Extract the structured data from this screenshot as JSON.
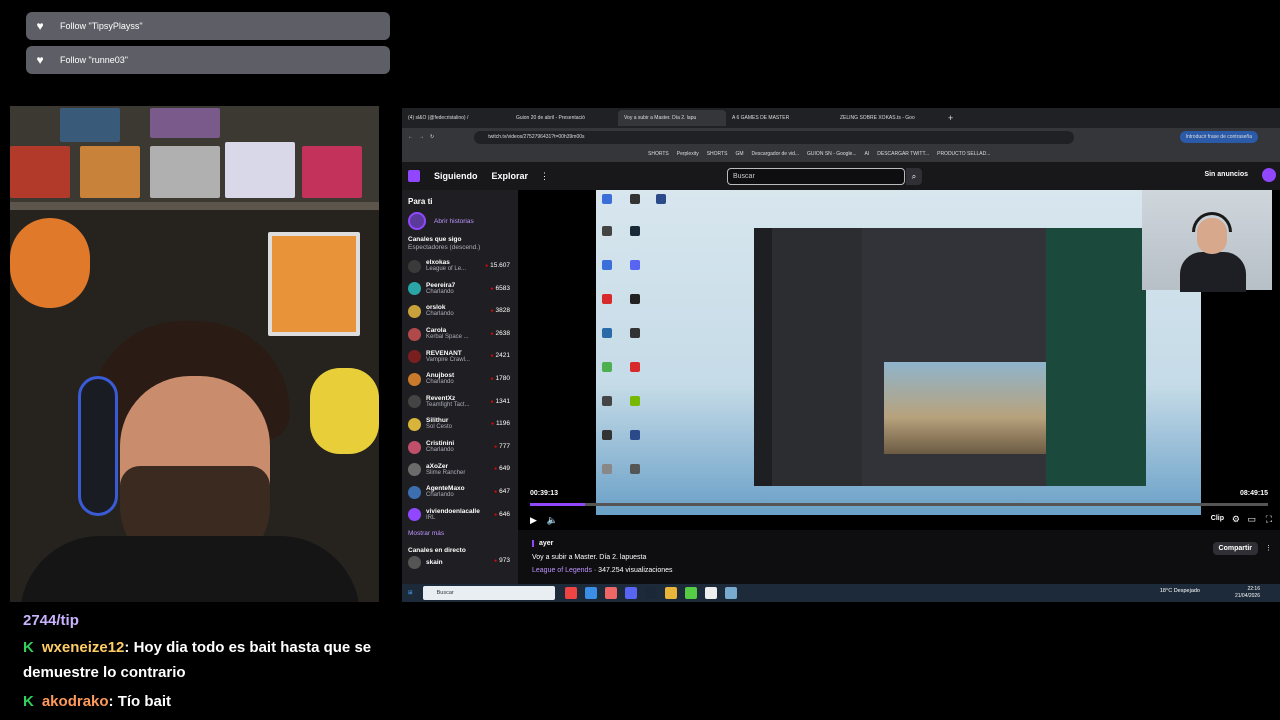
{
  "follows": [
    "Follow \"TipsyPlayss\"",
    "Follow \"runne03\""
  ],
  "chat": {
    "tip": "2744/tip",
    "messages": [
      {
        "user": "wxeneize12",
        "text": ": Hoy dia todo es bait hasta que se demuestre lo contrario"
      },
      {
        "user": "akodrako",
        "text": ": Tío bait"
      }
    ],
    "badge": "K"
  },
  "browser": {
    "tabs": [
      "(4) sl&O (@fedecristalino) /",
      "Guion 20 de abril - Presentació",
      "Voy a subir a Master. Día 2. lapu",
      "A 6 GAMES DE MASTER",
      "ZELING SOBRE XOKAS.ts - Goo"
    ],
    "url": "twitch.tv/videos/2752796431?t=00h39m00s",
    "password_button": "Introducir frase de contraseña",
    "bookmarks": [
      "SHORTS",
      "Perplexity",
      "SHORTS",
      "GM",
      "Descargador de vid...",
      "GUION SN - Google...",
      "AI",
      "DESCARGAR TWITT...",
      "PRODUCTO SELLAD..."
    ]
  },
  "twitch": {
    "nav": [
      "Siguiendo",
      "Explorar"
    ],
    "search_placeholder": "Buscar",
    "no_ads": "Sin anuncios",
    "sidebar": {
      "for_you": "Para ti",
      "open_stories": "Abrir historias",
      "followed_title": "Canales que sigo",
      "followed_sort": "Espectadores (descend.)",
      "channels": [
        {
          "name": "elxokas",
          "game": "League of Le...",
          "viewers": "15.607",
          "color": "#3a3a3a"
        },
        {
          "name": "Peereira7",
          "game": "Charlando",
          "viewers": "6583",
          "color": "#2aa6a6"
        },
        {
          "name": "orslok",
          "game": "Charlando",
          "viewers": "3828",
          "color": "#c9a13a"
        },
        {
          "name": "Carola",
          "game": "Kerbal Space ...",
          "viewers": "2638",
          "color": "#b04a4a"
        },
        {
          "name": "REVENANT",
          "game": "Vampire Crawl...",
          "viewers": "2421",
          "color": "#7a1f1f"
        },
        {
          "name": "Anujbost",
          "game": "Charlando",
          "viewers": "1780",
          "color": "#c97a2a"
        },
        {
          "name": "ReventXz",
          "game": "Teamfight Tact...",
          "viewers": "1341",
          "color": "#444"
        },
        {
          "name": "Silithur",
          "game": "Sol Cesto",
          "viewers": "1196",
          "color": "#d8b43a"
        },
        {
          "name": "Cristinini",
          "game": "Charlando",
          "viewers": "777",
          "color": "#c0506a"
        },
        {
          "name": "aXoZer",
          "game": "Slime Rancher",
          "viewers": "649",
          "color": "#6b6b6b"
        },
        {
          "name": "AgenteMaxo",
          "game": "Charlando",
          "viewers": "647",
          "color": "#3d6fb0"
        },
        {
          "name": "viviendoenlacalle",
          "game": "IRL",
          "viewers": "646",
          "color": "#9147ff"
        }
      ],
      "show_more": "Mostrar más",
      "live_title": "Canales en directo",
      "live": [
        {
          "name": "skain",
          "viewers": "973"
        }
      ]
    },
    "player": {
      "current": "00:39:13",
      "duration": "08:49:15",
      "progress": 0.074,
      "clip": "Clip"
    },
    "video": {
      "date": "ayer",
      "title": "Voy a subir a Master. Día 2. lapuesta",
      "game": "League of Legends",
      "views": "· 347.254 visualizaciones",
      "share": "Compartir"
    }
  },
  "taskbar": {
    "search": "Buscar",
    "weather": "18°C  Despejado",
    "time": "22:16",
    "date": "21/04/2026"
  }
}
